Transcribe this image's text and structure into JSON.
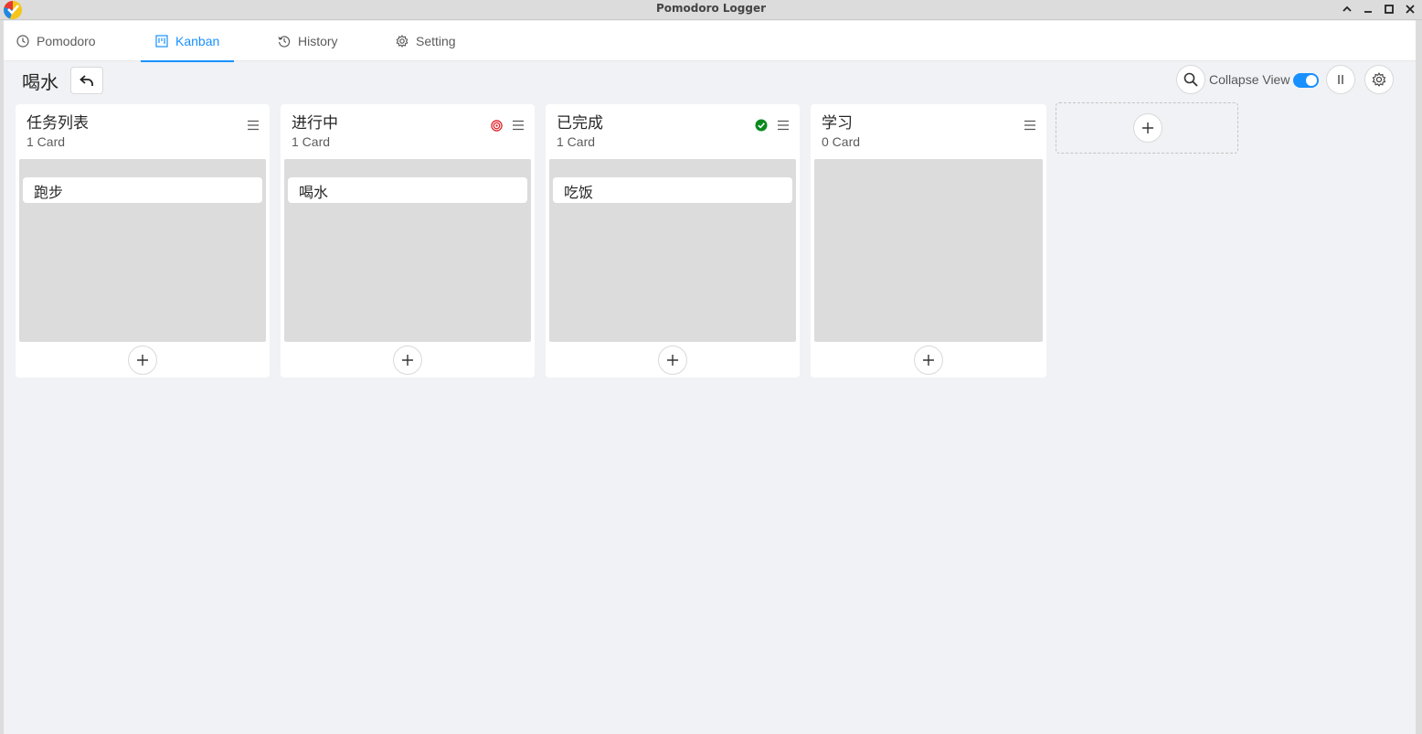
{
  "window": {
    "title": "Pomodoro Logger"
  },
  "menu": {
    "tabs": [
      {
        "label": "Pomodoro",
        "icon": "clock-icon",
        "active": false
      },
      {
        "label": "Kanban",
        "icon": "board-icon",
        "active": true
      },
      {
        "label": "History",
        "icon": "history-icon",
        "active": false
      },
      {
        "label": "Setting",
        "icon": "gear-icon",
        "active": false
      }
    ]
  },
  "board": {
    "title": "喝水",
    "collapse_view_label": "Collapse View",
    "collapse_view_enabled": true
  },
  "columns": [
    {
      "name": "任务列表",
      "count": "1 Card",
      "status_icon": null,
      "cards": [
        "跑步"
      ]
    },
    {
      "name": "进行中",
      "count": "1 Card",
      "status_icon": "target-icon",
      "cards": [
        "喝水"
      ]
    },
    {
      "name": "已完成",
      "count": "1 Card",
      "status_icon": "check-circle-icon",
      "cards": [
        "吃饭"
      ]
    },
    {
      "name": "学习",
      "count": "0 Card",
      "status_icon": null,
      "cards": []
    }
  ],
  "colors": {
    "accent": "#1890ff",
    "target_red": "#e0262b",
    "done_green": "#0a8a1f",
    "background": "#f0f2f5",
    "column_body": "#dcdcdc"
  }
}
